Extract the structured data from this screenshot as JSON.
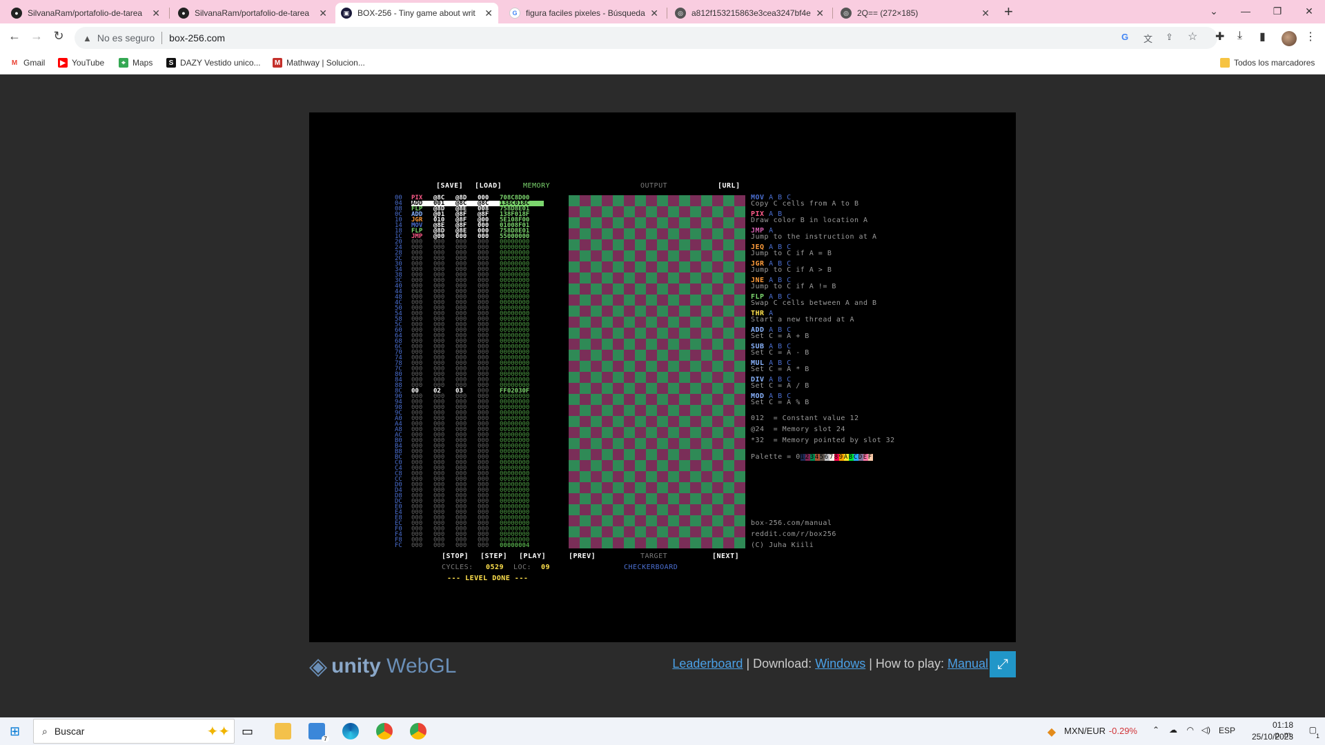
{
  "browser": {
    "tabs": [
      {
        "title": "SilvanaRam/portafolio-de-tarea",
        "icon": "github-icon"
      },
      {
        "title": "SilvanaRam/portafolio-de-tarea",
        "icon": "github-icon"
      },
      {
        "title": "BOX-256 - Tiny game about writ",
        "icon": "box256-icon"
      },
      {
        "title": "figura faciles pixeles - Búsqueda",
        "icon": "google-icon"
      },
      {
        "title": "a812f153215863e3cea3247bf4e",
        "icon": "globe-icon"
      },
      {
        "title": "2Q== (272×185)",
        "icon": "globe-icon"
      }
    ],
    "address": {
      "security": "No es seguro",
      "url": "box-256.com"
    },
    "bookmarks": [
      "Gmail",
      "YouTube",
      "Maps",
      "DAZY Vestido unico...",
      "Mathway | Solucion..."
    ],
    "all_bookmarks": "Todos los marcadores"
  },
  "game": {
    "menu": {
      "save": "[SAVE]",
      "load": "[LOAD]",
      "memory": "MEMORY",
      "output": "OUTPUT",
      "url": "[URL]"
    },
    "memory_rows": [
      {
        "addr": "00",
        "op": "PIX",
        "a": "@8C",
        "b": "@8D",
        "c": "000",
        "hex": "708C8D00",
        "opc": "#ff5c8a",
        "hl": false
      },
      {
        "addr": "04",
        "op": "ADD",
        "a": "001",
        "b": "@8C",
        "c": "@8C",
        "hex": "138C018C",
        "opc": "#ffffff",
        "hl": true
      },
      {
        "addr": "08",
        "op": "FLP",
        "a": "@8D",
        "b": "@8E",
        "c": "008",
        "hex": "758D8E01",
        "opc": "#7cd66e",
        "hl": false
      },
      {
        "addr": "0C",
        "op": "ADD",
        "a": "@01",
        "b": "@8F",
        "c": "@8F",
        "hex": "138F018F",
        "opc": "#8ab4ff",
        "hl": false
      },
      {
        "addr": "10",
        "op": "JGR",
        "a": "010",
        "b": "@8F",
        "c": "@00",
        "hex": "5E108F00",
        "opc": "#ff9d3c",
        "hl": false
      },
      {
        "addr": "14",
        "op": "MOV",
        "a": "@8E",
        "b": "@8F",
        "c": "000",
        "hex": "01008F01",
        "opc": "#4b6fd1",
        "hl": false
      },
      {
        "addr": "18",
        "op": "FLP",
        "a": "@8D",
        "b": "@8E",
        "c": "000",
        "hex": "758D8E01",
        "opc": "#7cd66e",
        "hl": false
      },
      {
        "addr": "1C",
        "op": "JMP",
        "a": "@00",
        "b": "000",
        "c": "000",
        "hex": "55000000",
        "opc": "#ff5c8a",
        "hl": false
      }
    ],
    "special_row": {
      "addr": "8C",
      "a": "00",
      "b": "02",
      "c": "03",
      "hex": "FF02030F"
    },
    "last_hex": "00000004",
    "controls": {
      "stop": "[STOP]",
      "step": "[STEP]",
      "play": "[PLAY]",
      "prev": "[PREV]",
      "target": "TARGET",
      "next": "[NEXT]"
    },
    "cycles_label": "CYCLES:",
    "cycles": "0529",
    "loc_label": "LOC:",
    "loc": "09",
    "level_done": "--- LEVEL DONE ---",
    "level_name": "CHECKERBOARD",
    "reference": [
      {
        "name": "MOV",
        "args": "A B C",
        "desc": "Copy C cells from A to B",
        "color": "#4b6fd1"
      },
      {
        "name": "PIX",
        "args": "A B",
        "desc": "Draw color B in location A",
        "color": "#ff5c8a"
      },
      {
        "name": "JMP",
        "args": "A",
        "desc": "Jump to the instruction at A",
        "color": "#d45fb0"
      },
      {
        "name": "JEQ",
        "args": "A B C",
        "desc": "Jump to C if A = B",
        "color": "#ff9d3c"
      },
      {
        "name": "JGR",
        "args": "A B C",
        "desc": "Jump to C if A > B",
        "color": "#ff9d3c"
      },
      {
        "name": "JNE",
        "args": "A B C",
        "desc": "Jump to C if A != B",
        "color": "#ff9d3c"
      },
      {
        "name": "FLP",
        "args": "A B C",
        "desc": "Swap C cells between A and B",
        "color": "#7cd66e"
      },
      {
        "name": "THR",
        "args": "A",
        "desc": "Start a new thread at A",
        "color": "#ffe14d"
      },
      {
        "name": "ADD",
        "args": "A B C",
        "desc": "Set C = A + B",
        "color": "#8ab4ff"
      },
      {
        "name": "SUB",
        "args": "A B C",
        "desc": "Set C = A - B",
        "color": "#8ab4ff"
      },
      {
        "name": "MUL",
        "args": "A B C",
        "desc": "Set C = A * B",
        "color": "#8ab4ff"
      },
      {
        "name": "DIV",
        "args": "A B C",
        "desc": "Set C = A / B",
        "color": "#8ab4ff"
      },
      {
        "name": "MOD",
        "args": "A B C",
        "desc": "Set C = A % B",
        "color": "#8ab4ff"
      }
    ],
    "notes": [
      "012  = Constant value 12",
      "@24  = Memory slot 24",
      "*32  = Memory pointed by slot 32"
    ],
    "palette_label": "Palette = 0",
    "palette_colors": [
      "#1d2b53",
      "#7e2553",
      "#008751",
      "#ab5236",
      "#5f574f",
      "#c2c3c7",
      "#fff1e8",
      "#ff004d",
      "#ffa300",
      "#ffec27",
      "#00e436",
      "#29adff",
      "#83769c",
      "#ff77a8",
      "#ffccaa"
    ],
    "palette_digits": "123456789ABCDEF",
    "credits": [
      "box-256.com/manual",
      "reddit.com/r/box256",
      "(C) Juha Kiili"
    ]
  },
  "footer": {
    "unity": "unity",
    "webgl": "WebGL",
    "leaderboard": "Leaderboard",
    "sep1": " | Download: ",
    "windows": "Windows",
    "sep2": " | How to play: ",
    "manual": "Manual"
  },
  "taskbar": {
    "search": "Buscar",
    "mail_badge": "7",
    "currency": "MXN/EUR",
    "change": "-0.29%",
    "lang": "ESP",
    "time": "01:18 p. m.",
    "date": "25/10/2023",
    "notif": "1"
  }
}
